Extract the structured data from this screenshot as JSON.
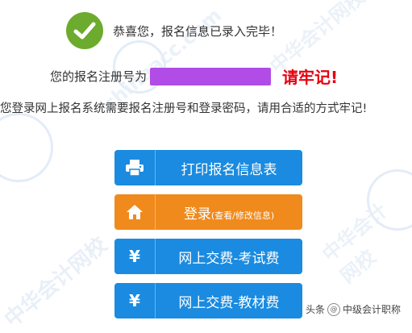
{
  "watermark": {
    "text": "中华会计网校",
    "url": "chinaacc.com"
  },
  "success": {
    "message": "恭喜您，报名信息已录入完毕！",
    "icon": "check-icon"
  },
  "registration": {
    "label": "您的报名注册号为",
    "remember": "请牢记!"
  },
  "instruction": "您登录网上报名系统需要报名注册号和登录密码，请用合适的方式牢记!",
  "buttons": {
    "print": {
      "label": "打印报名信息表",
      "icon": "printer-icon"
    },
    "login": {
      "label": "登录",
      "sub": "(查看/修改信息)",
      "icon": "home-icon"
    },
    "exam_fee": {
      "label": "网上交费-考试费",
      "icon": "yen-icon",
      "symbol": "¥"
    },
    "book_fee": {
      "label": "网上交费-教材费",
      "icon": "yen-icon",
      "symbol": "¥"
    }
  },
  "attribution": {
    "prefix": "头条",
    "name": "中级会计职称"
  },
  "colors": {
    "success_green": "#6cab2d",
    "mask_purple": "#b14ce6",
    "remember_red": "#e60012",
    "button_blue": "#1a8be0",
    "button_orange": "#f08a1c"
  }
}
